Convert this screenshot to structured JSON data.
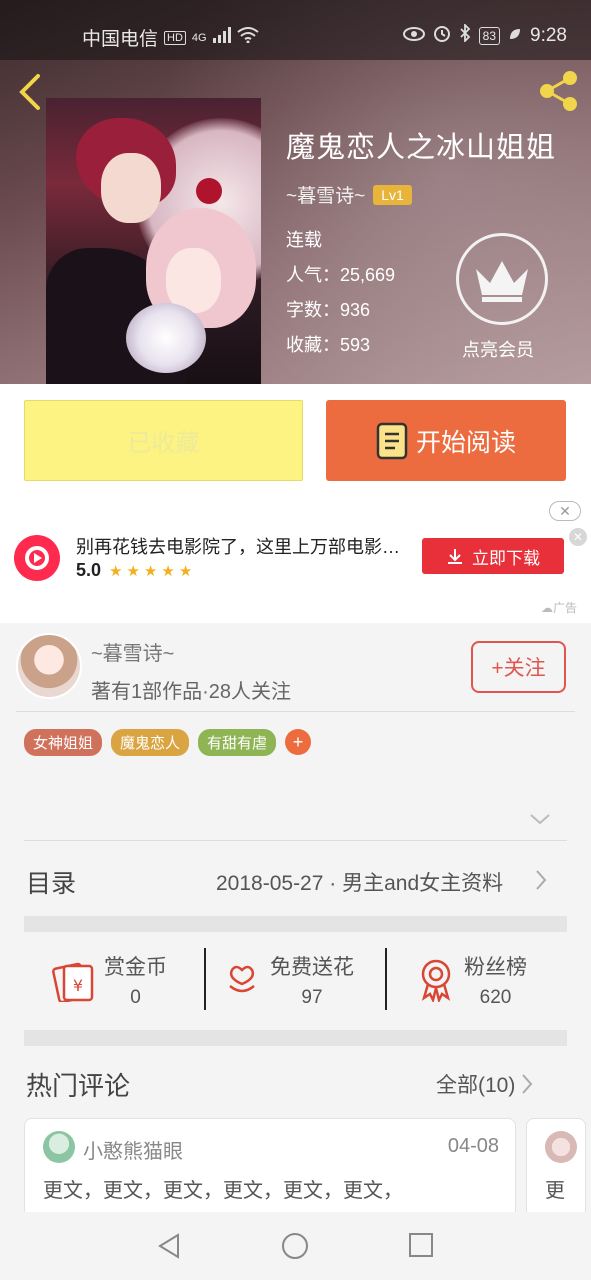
{
  "status_bar": {
    "carrier": "中国电信",
    "hd": "HD",
    "network": "4G",
    "battery": "83",
    "time": "9:28"
  },
  "book": {
    "title": "魔鬼恋人之冰山姐姐",
    "author": "~暮雪诗~",
    "level": "Lv1",
    "status": "连载",
    "popularity": "人气：25,669",
    "word_count": "字数：936",
    "favorites": "收藏：593",
    "vip_label": "点亮会员"
  },
  "actions": {
    "favorited_label": "已收藏",
    "read_label": "开始阅读"
  },
  "ad": {
    "title": "别再花钱去电影院了，这里上万部电影免费看",
    "rating": "5.0",
    "stars": "★★★★★",
    "download_label": "立即下载",
    "ad_tag": "广告"
  },
  "author_block": {
    "name": "~暮雪诗~",
    "stats": "著有1部作品·28人关注",
    "follow_label": "+关注"
  },
  "tags": [
    {
      "label": "女神姐姐",
      "color": "#d0715c"
    },
    {
      "label": "魔鬼恋人",
      "color": "#d9a441"
    },
    {
      "label": "有甜有虐",
      "color": "#8fb454"
    }
  ],
  "tag_add": "+",
  "toc": {
    "title": "目录",
    "latest": "2018-05-27 · 男主and女主资料"
  },
  "stats": {
    "reward": {
      "label": "赏金币",
      "value": "0"
    },
    "flowers": {
      "label": "免费送花",
      "value": "97"
    },
    "fans": {
      "label": "粉丝榜",
      "value": "620"
    }
  },
  "comments_section": {
    "title": "热门评论",
    "all_label": "全部(10)"
  },
  "comments": [
    {
      "user": "小憨熊猫眼",
      "date": "04-08",
      "text": "更文，更文，更文，更文，更文，更文，"
    }
  ],
  "next_comment_preview": "更",
  "colors": {
    "accent": "#ec6c3f",
    "favorite_bg": "#fdf383",
    "follow": "#e0564e",
    "ad_button": "#e8303a"
  }
}
